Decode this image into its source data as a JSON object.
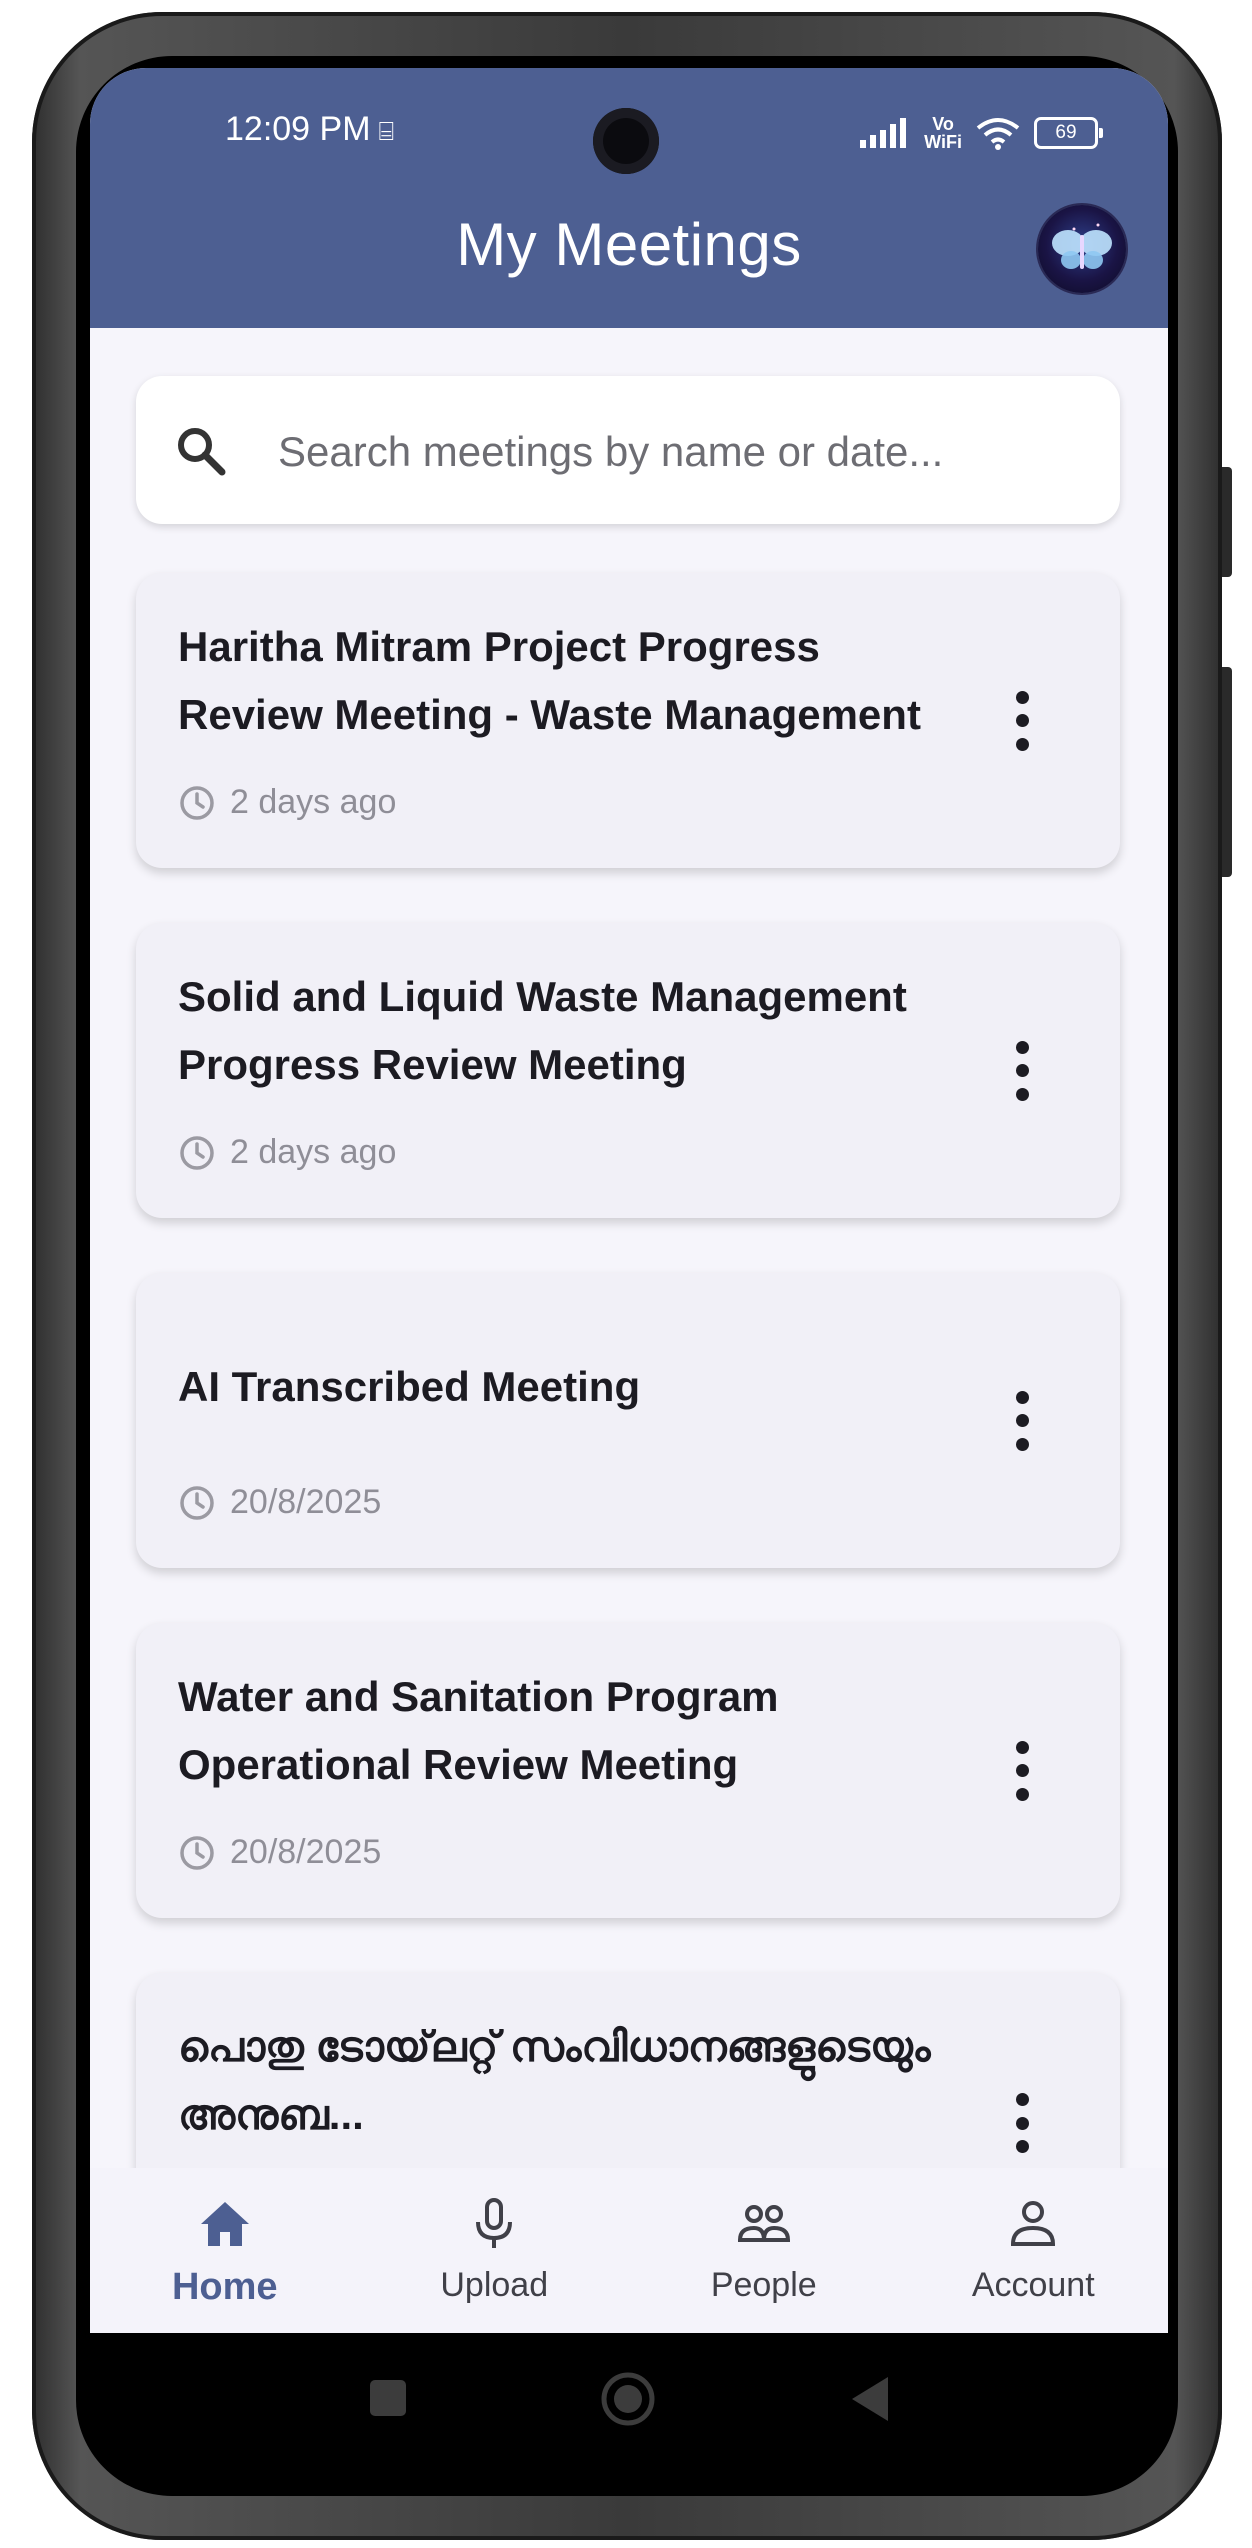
{
  "status_bar": {
    "time": "12:09 PM",
    "vo": "Vo",
    "wifi_label": "WiFi",
    "battery": "69"
  },
  "header": {
    "title": "My Meetings",
    "accent_color": "#4d5f92"
  },
  "search": {
    "placeholder": "Search meetings by name or date..."
  },
  "meetings": [
    {
      "title": "Haritha Mitram Project Progress Review Meeting - Waste Management",
      "time": "2 days ago"
    },
    {
      "title": "Solid and Liquid Waste Management Progress Review Meeting",
      "time": "2 days ago"
    },
    {
      "title": "AI Transcribed Meeting",
      "time": "20/8/2025"
    },
    {
      "title": "Water and Sanitation Program Operational Review Meeting",
      "time": "20/8/2025"
    },
    {
      "title": "പൊതു ടോയ്‌ലറ്റ് സംവിധാനങ്ങളുടെയും അനുബ...",
      "time": ""
    }
  ],
  "bottom_nav": {
    "items": [
      {
        "label": "Home",
        "icon": "home-icon",
        "active": true
      },
      {
        "label": "Upload",
        "icon": "microphone-icon",
        "active": false
      },
      {
        "label": "People",
        "icon": "people-icon",
        "active": false
      },
      {
        "label": "Account",
        "icon": "account-icon",
        "active": false
      }
    ]
  }
}
